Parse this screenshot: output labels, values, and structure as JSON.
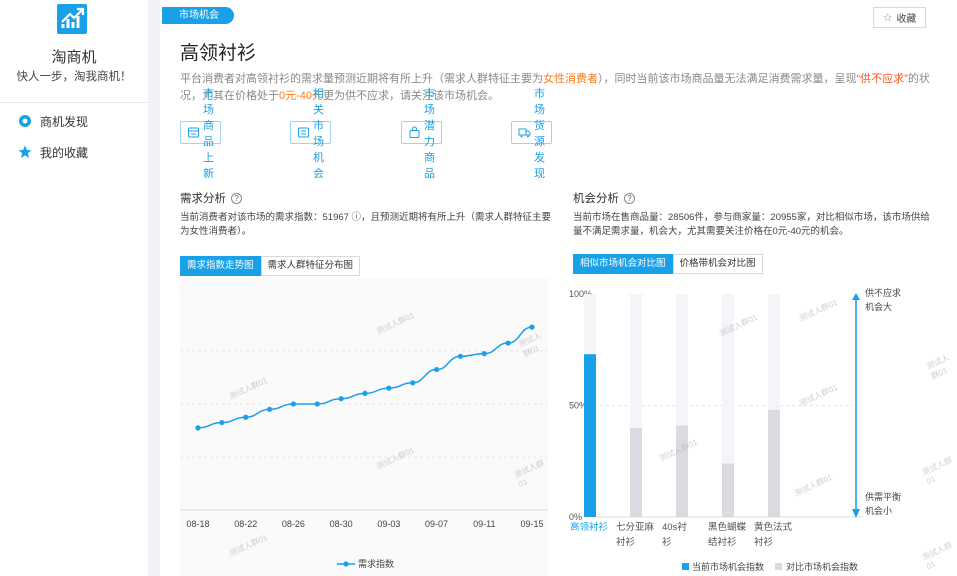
{
  "app": {
    "name": "淘商机",
    "slogan": "快人一步，淘我商机！"
  },
  "sidebar": {
    "items": [
      {
        "label": "商机发现",
        "icon": "discover-icon"
      },
      {
        "label": "我的收藏",
        "icon": "star-icon"
      }
    ]
  },
  "header": {
    "tag": "市场机会",
    "favorite_label": "收藏",
    "title": "高领衬衫",
    "desc_parts": [
      "平台消费者对高领衬衫的需求量预测近期将有所上升（需求人群特征主要为",
      "女性消费者",
      "），同时当前该市场商品量无法满足消费需求量，呈现",
      "“供不应求”",
      "的状况，尤其在价格处于",
      "0元-40元",
      "更为供不应求，请关注该市场机会。"
    ]
  },
  "tools": [
    {
      "label": "市场商品上新",
      "icon": "shop-icon"
    },
    {
      "label": "相关市场机会",
      "icon": "list-icon"
    },
    {
      "label": "市场潜力商品",
      "icon": "bag-icon"
    },
    {
      "label": "市场货源发现",
      "icon": "truck-icon"
    }
  ],
  "demand": {
    "title": "需求分析",
    "desc": "当前消费者对该市场的需求指数：51967 ⓘ，且预测近期将有所上升（需求人群特征主要为女性消费者）。",
    "tabs": [
      "需求指数走势图",
      "需求人群特征分布图"
    ],
    "legend": "需求指数",
    "watermark": "测试人群01"
  },
  "opportunity": {
    "title": "机会分析",
    "desc": "当前市场在售商品量：28506件，参与商家量：20955家，对比相似市场，该市场供给量不满足需求量，机会大，尤其需要关注价格在0元-40元的机会。",
    "tabs": [
      "相似市场机会对比图",
      "价格带机会对比图"
    ],
    "legend": [
      "当前市场机会指数",
      "对比市场机会指数"
    ],
    "right_top": [
      "供不应求",
      "机会大"
    ],
    "right_bottom": [
      "供需平衡",
      "机会小"
    ]
  },
  "colors": {
    "accent": "#1aa0e8",
    "compare_bar": "#d9dbe0",
    "orange": "#ff7a18"
  },
  "chart_data": [
    {
      "type": "line",
      "x": [
        "08-18",
        "08-20",
        "08-22",
        "08-24",
        "08-26",
        "08-28",
        "08-30",
        "09-01",
        "09-03",
        "09-05",
        "09-07",
        "09-09",
        "09-11",
        "09-13",
        "09-15"
      ],
      "x_ticks": [
        "08-18",
        "08-22",
        "08-26",
        "08-30",
        "09-03",
        "09-07",
        "09-11",
        "09-15"
      ],
      "series": [
        {
          "name": "需求指数",
          "values": [
            31,
            33,
            35,
            38,
            40,
            40,
            42,
            44,
            46,
            48,
            53,
            58,
            59,
            63,
            69
          ]
        }
      ],
      "ylim": [
        0,
        80
      ],
      "grid": true
    },
    {
      "type": "bar",
      "categories": [
        "高领衬衫",
        "七分亚麻衬衫",
        "40s衬衫",
        "黑色蝴蝶结衬衫",
        "黄色法式衬衫"
      ],
      "series": [
        {
          "name": "当前市场机会指数",
          "values": [
            73,
            null,
            null,
            null,
            null
          ]
        },
        {
          "name": "对比市场机会指数",
          "values": [
            null,
            40,
            41,
            24,
            48
          ]
        }
      ],
      "y_ticks": [
        "0%",
        "50%",
        "100%"
      ],
      "ylim": [
        0,
        100
      ]
    }
  ]
}
